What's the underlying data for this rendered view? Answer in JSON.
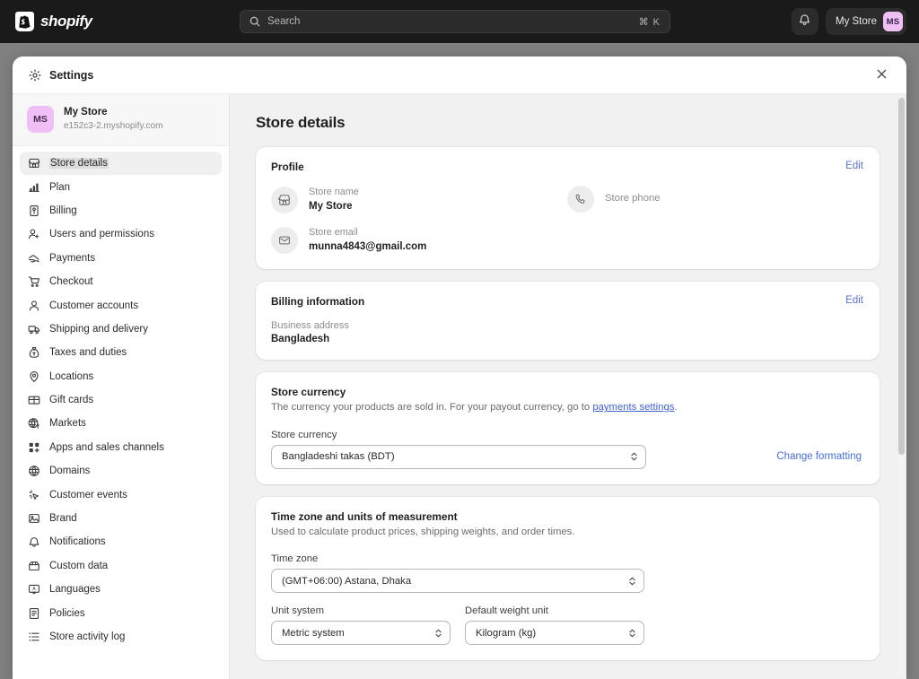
{
  "topbar": {
    "logo_text": "shopify",
    "logo_icon": "shopify-bag-icon",
    "search": {
      "placeholder": "Search",
      "shortcut": "⌘ K",
      "icon": "search-icon"
    },
    "notifications_icon": "bell-icon",
    "store_button_label": "My Store",
    "avatar_initials": "MS",
    "avatar_color": "#f0bff5",
    "background_color": "#1a1a1a"
  },
  "modal": {
    "title": "Settings",
    "title_icon": "gear-icon",
    "close_icon": "close-icon"
  },
  "sidebar": {
    "store": {
      "initials": "MS",
      "name": "My Store",
      "url": "e152c3-2.myshopify.com"
    },
    "items": [
      {
        "label": "Store details",
        "icon": "storefront-icon",
        "active": true
      },
      {
        "label": "Plan",
        "icon": "chart-bar-icon",
        "active": false
      },
      {
        "label": "Billing",
        "icon": "receipt-icon",
        "active": false
      },
      {
        "label": "Users and permissions",
        "icon": "user-add-icon",
        "active": false
      },
      {
        "label": "Payments",
        "icon": "cash-hand-icon",
        "active": false
      },
      {
        "label": "Checkout",
        "icon": "shopping-cart-icon",
        "active": false
      },
      {
        "label": "Customer accounts",
        "icon": "person-icon",
        "active": false
      },
      {
        "label": "Shipping and delivery",
        "icon": "truck-icon",
        "active": false
      },
      {
        "label": "Taxes and duties",
        "icon": "money-bag-icon",
        "active": false
      },
      {
        "label": "Locations",
        "icon": "map-pin-icon",
        "active": false
      },
      {
        "label": "Gift cards",
        "icon": "gift-card-icon",
        "active": false
      },
      {
        "label": "Markets",
        "icon": "globe-dollar-icon",
        "active": false
      },
      {
        "label": "Apps and sales channels",
        "icon": "apps-grid-icon",
        "active": false
      },
      {
        "label": "Domains",
        "icon": "globe-icon",
        "active": false
      },
      {
        "label": "Customer events",
        "icon": "cursor-click-icon",
        "active": false
      },
      {
        "label": "Brand",
        "icon": "image-icon",
        "active": false
      },
      {
        "label": "Notifications",
        "icon": "bell-icon",
        "active": false
      },
      {
        "label": "Custom data",
        "icon": "database-icon",
        "active": false
      },
      {
        "label": "Languages",
        "icon": "translate-icon",
        "active": false
      },
      {
        "label": "Policies",
        "icon": "document-icon",
        "active": false
      },
      {
        "label": "Store activity log",
        "icon": "list-icon",
        "active": false
      }
    ]
  },
  "main": {
    "page_title": "Store details",
    "profile": {
      "title": "Profile",
      "edit_label": "Edit",
      "store_name_label": "Store name",
      "store_name_value": "My Store",
      "store_name_icon": "storefront-icon",
      "store_email_label": "Store email",
      "store_email_value": "munna4843@gmail.com",
      "store_email_icon": "envelope-icon",
      "store_phone_label": "Store phone",
      "store_phone_value": "",
      "store_phone_icon": "phone-icon"
    },
    "billing": {
      "title": "Billing information",
      "edit_label": "Edit",
      "address_label": "Business address",
      "address_value": "Bangladesh"
    },
    "currency": {
      "title": "Store currency",
      "description_before": "The currency your products are sold in. For your payout currency, go to ",
      "link_text": "payments settings",
      "description_after": ".",
      "field_label": "Store currency",
      "selected": "Bangladeshi takas (BDT)",
      "change_formatting_label": "Change formatting"
    },
    "timezone": {
      "title": "Time zone and units of measurement",
      "description": "Used to calculate product prices, shipping weights, and order times.",
      "timezone_label": "Time zone",
      "timezone_selected": "(GMT+06:00) Astana, Dhaka",
      "unit_system_label": "Unit system",
      "unit_system_selected": "Metric system",
      "weight_unit_label": "Default weight unit",
      "weight_unit_selected": "Kilogram (kg)"
    }
  },
  "colors": {
    "accent_link": "#4a6fc9",
    "page_background": "#f1f1f1",
    "card_background": "#ffffff"
  }
}
